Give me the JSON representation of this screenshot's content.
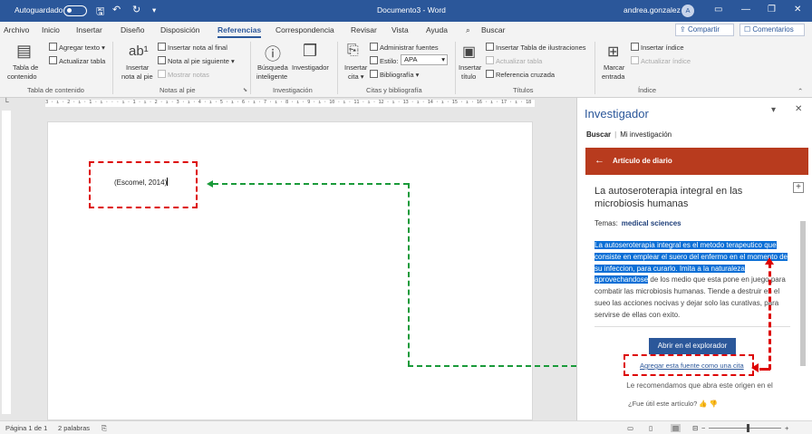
{
  "titlebar": {
    "autosave_label": "Autoguardado",
    "doc_title": "Documento3 - Word",
    "user_name": "andrea.gonzalez",
    "user_initial": "A"
  },
  "tabs": [
    "Archivo",
    "Inicio",
    "Insertar",
    "Diseño",
    "Disposición",
    "Referencias",
    "Correspondencia",
    "Revisar",
    "Vista",
    "Ayuda",
    "Buscar"
  ],
  "active_tab": "Referencias",
  "share_label": "Compartir",
  "comments_label": "Comentarios",
  "ribbon": {
    "toc": {
      "tabla_line1": "Tabla de",
      "tabla_line2": "contenido",
      "agregar_texto": "Agregar texto",
      "actualizar_tabla": "Actualizar tabla",
      "group": "Tabla de contenido"
    },
    "footnotes": {
      "insertar_line1": "Insertar",
      "insertar_line2": "nota al pie",
      "insertar_nota_final": "Insertar nota al final",
      "nota_siguiente": "Nota al pie siguiente",
      "mostrar_notas": "Mostrar notas",
      "group": "Notas al pie"
    },
    "research": {
      "busqueda_line1": "Búsqueda",
      "busqueda_line2": "inteligente",
      "investigador": "Investigador",
      "group": "Investigación"
    },
    "citations": {
      "insertar_line1": "Insertar",
      "insertar_line2": "cita",
      "administrar": "Administrar fuentes",
      "estilo_label": "Estilo:",
      "estilo_value": "APA",
      "bibliografia": "Bibliografía",
      "group": "Citas y bibliografía"
    },
    "captions": {
      "insertar_line1": "Insertar",
      "insertar_line2": "título",
      "insertar_tabla_ilustraciones": "Insertar Tabla de ilustraciones",
      "actualizar_tabla": "Actualizar tabla",
      "referencia_cruzada": "Referencia cruzada",
      "group": "Títulos"
    },
    "index": {
      "marcar_line1": "Marcar",
      "marcar_line2": "entrada",
      "insertar_indice": "Insertar índice",
      "actualizar_indice": "Actualizar índice",
      "group": "Índice"
    }
  },
  "ruler_text": "3 · ı · 2 · ı · 1 · ı · · · ı · 1 · ı · 2 · ı · 3 · ı · 4 · ı · 5 · ı · 6 · ı · 7 · ı · 8 · ı · 9 · ı · 10 · ı · 11 · ı · 12 · ı · 13 · ı · 14 · ı · 15 · ı · 16 · ı · 17 · ı · 18",
  "document": {
    "citation_text": "(Escomel, 2014)"
  },
  "pane": {
    "title": "Investigador",
    "tab_buscar": "Buscar",
    "tab_mi_investigacion": "Mi investigación",
    "article_header": "Artículo de diario",
    "article_title": "La autoseroterapia integral en las microbiosis humanas",
    "temas_label": "Temas:",
    "temas_value": "medical sciences",
    "abstract_highlighted": "La autoseroterapia integral es el metodo terapeutico que consiste en emplear el suero del enfermo en el momento de su infeccion, para curarlo. Imita a la naturaleza aprovechandose",
    "abstract_rest": " de los medio que esta pone en juego para combatir las microbiosis humanas. Tiende a destruir en el sueo las acciones nocivas y dejar solo las curativas, para servirse de ellas con exito.",
    "open_button": "Abrir en el explorador",
    "add_cite_link": "Agregar esta fuente como una cita",
    "recommend_text": "Le recomendamos que abra este origen en el",
    "feedback_text": "¿Fue útil este artículo?"
  },
  "statusbar": {
    "page": "Página 1 de 1",
    "words": "2 palabras",
    "zoom_minus": "−",
    "zoom_plus": "+"
  },
  "colors": {
    "word_blue": "#2b579a",
    "article_header": "#b83b1e",
    "highlight": "#0b6fd6",
    "annot_red": "#dd0000",
    "annot_green": "#1a9a3a"
  }
}
